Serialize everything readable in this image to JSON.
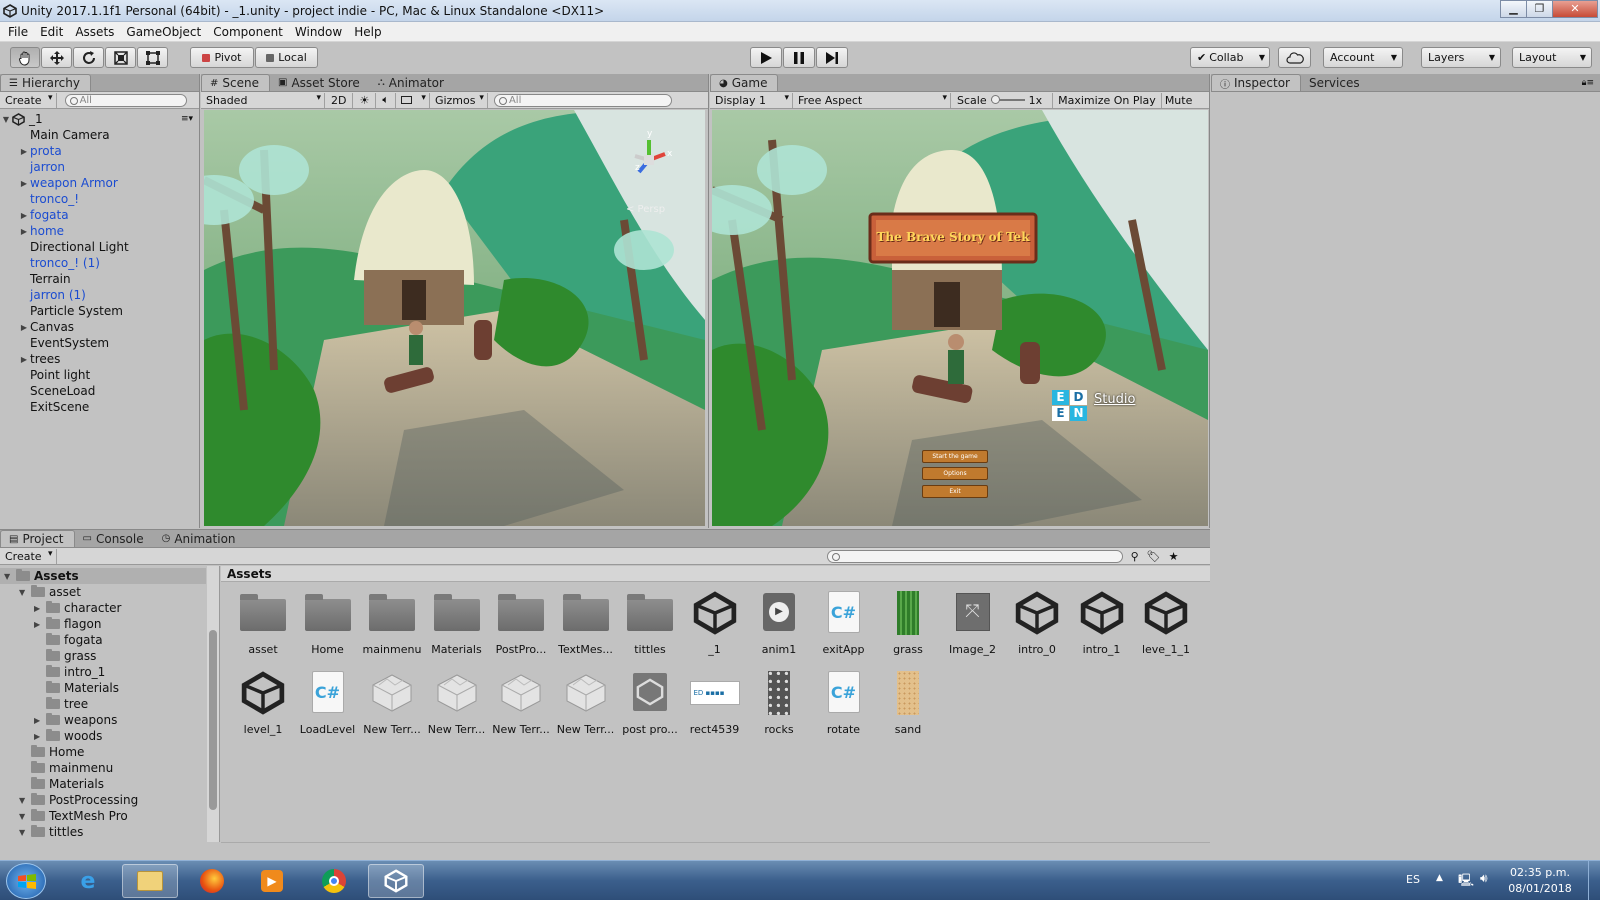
{
  "window": {
    "title": "Unity 2017.1.1f1 Personal (64bit) - _1.unity - project indie - PC, Mac & Linux Standalone <DX11>"
  },
  "menu": [
    "File",
    "Edit",
    "Assets",
    "GameObject",
    "Component",
    "Window",
    "Help"
  ],
  "toolbar": {
    "pivot": "Pivot",
    "local": "Local",
    "collab": "Collab",
    "account": "Account",
    "layers": "Layers",
    "layout": "Layout"
  },
  "hierarchy": {
    "tab": "Hierarchy",
    "create": "Create",
    "search_placeholder": "All",
    "scene": "_1",
    "items": [
      {
        "name": "Main Camera",
        "arrow": false,
        "prefab": false
      },
      {
        "name": "prota",
        "arrow": true,
        "prefab": true
      },
      {
        "name": "jarron",
        "arrow": false,
        "prefab": true
      },
      {
        "name": "weapon Armor",
        "arrow": true,
        "prefab": true
      },
      {
        "name": "tronco_!",
        "arrow": false,
        "prefab": true
      },
      {
        "name": "fogata",
        "arrow": true,
        "prefab": true
      },
      {
        "name": "home",
        "arrow": true,
        "prefab": true
      },
      {
        "name": "Directional Light",
        "arrow": false,
        "prefab": false
      },
      {
        "name": "tronco_! (1)",
        "arrow": false,
        "prefab": true
      },
      {
        "name": "Terrain",
        "arrow": false,
        "prefab": false
      },
      {
        "name": "jarron (1)",
        "arrow": false,
        "prefab": true
      },
      {
        "name": "Particle System",
        "arrow": false,
        "prefab": false
      },
      {
        "name": "Canvas",
        "arrow": true,
        "prefab": false
      },
      {
        "name": "EventSystem",
        "arrow": false,
        "prefab": false
      },
      {
        "name": "trees",
        "arrow": true,
        "prefab": false
      },
      {
        "name": "Point light",
        "arrow": false,
        "prefab": false
      },
      {
        "name": "SceneLoad",
        "arrow": false,
        "prefab": false
      },
      {
        "name": "ExitScene",
        "arrow": false,
        "prefab": false
      }
    ]
  },
  "scene": {
    "tabs": [
      "Scene",
      "Asset Store",
      "Animator"
    ],
    "shading": "Shaded",
    "mode2d": "2D",
    "gizmos": "Gizmos",
    "search_placeholder": "All",
    "persp": "< Persp"
  },
  "game": {
    "tab": "Game",
    "display": "Display 1",
    "aspect": "Free Aspect",
    "scale_label": "Scale",
    "scale_value": "1x",
    "maximize": "Maximize On Play",
    "mute": "Mute A",
    "ui_title": "The Brave Story of Tek",
    "studio": "Studio",
    "logo_letters": [
      "E",
      "D",
      "E",
      "N"
    ],
    "buttons": [
      "Start the game",
      "Options",
      "Exit"
    ]
  },
  "inspector": {
    "tabs": [
      "Inspector",
      "Services"
    ]
  },
  "project": {
    "tabs": [
      "Project",
      "Console",
      "Animation"
    ],
    "create": "Create",
    "breadcrumb": "Assets",
    "tree": [
      {
        "name": "Assets",
        "level": 0,
        "arrow": true,
        "header": true
      },
      {
        "name": "asset",
        "level": 1,
        "arrow": true
      },
      {
        "name": "character",
        "level": 2,
        "arrow": true
      },
      {
        "name": "flagon",
        "level": 2,
        "arrow": true
      },
      {
        "name": "fogata",
        "level": 2,
        "arrow": false
      },
      {
        "name": "grass",
        "level": 2,
        "arrow": false
      },
      {
        "name": "intro_1",
        "level": 2,
        "arrow": false
      },
      {
        "name": "Materials",
        "level": 2,
        "arrow": false
      },
      {
        "name": "tree",
        "level": 2,
        "arrow": false
      },
      {
        "name": "weapons",
        "level": 2,
        "arrow": true
      },
      {
        "name": "woods",
        "level": 2,
        "arrow": true
      },
      {
        "name": "Home",
        "level": 1,
        "arrow": false
      },
      {
        "name": "mainmenu",
        "level": 1,
        "arrow": false
      },
      {
        "name": "Materials",
        "level": 1,
        "arrow": false
      },
      {
        "name": "PostProcessing",
        "level": 1,
        "arrow": true
      },
      {
        "name": "TextMesh Pro",
        "level": 1,
        "arrow": true
      },
      {
        "name": "tittles",
        "level": 1,
        "arrow": true
      }
    ],
    "assets": [
      {
        "label": "asset",
        "kind": "folder"
      },
      {
        "label": "Home",
        "kind": "folder"
      },
      {
        "label": "mainmenu",
        "kind": "folder"
      },
      {
        "label": "Materials",
        "kind": "folder"
      },
      {
        "label": "PostPro...",
        "kind": "folder"
      },
      {
        "label": "TextMes...",
        "kind": "folder"
      },
      {
        "label": "tittles",
        "kind": "folder"
      },
      {
        "label": "_1",
        "kind": "unity"
      },
      {
        "label": "anim1",
        "kind": "anim"
      },
      {
        "label": "exitApp",
        "kind": "script"
      },
      {
        "label": "grass",
        "kind": "grass"
      },
      {
        "label": "Image_2",
        "kind": "image"
      },
      {
        "label": "intro_0",
        "kind": "unity"
      },
      {
        "label": "intro_1",
        "kind": "unity"
      },
      {
        "label": "leve_1_1",
        "kind": "unity"
      },
      {
        "label": "level_1",
        "kind": "unity"
      },
      {
        "label": "LoadLevel",
        "kind": "script"
      },
      {
        "label": "New Terr...",
        "kind": "terrain"
      },
      {
        "label": "New Terr...",
        "kind": "terrain"
      },
      {
        "label": "New Terr...",
        "kind": "terrain"
      },
      {
        "label": "New Terr...",
        "kind": "terrain"
      },
      {
        "label": "post pro...",
        "kind": "postpro"
      },
      {
        "label": "rect4539",
        "kind": "rect"
      },
      {
        "label": "rocks",
        "kind": "rocks"
      },
      {
        "label": "rotate",
        "kind": "script"
      },
      {
        "label": "sand",
        "kind": "sand"
      }
    ]
  },
  "taskbar": {
    "lang": "ES",
    "time": "02:35 p.m.",
    "date": "08/01/2018"
  }
}
